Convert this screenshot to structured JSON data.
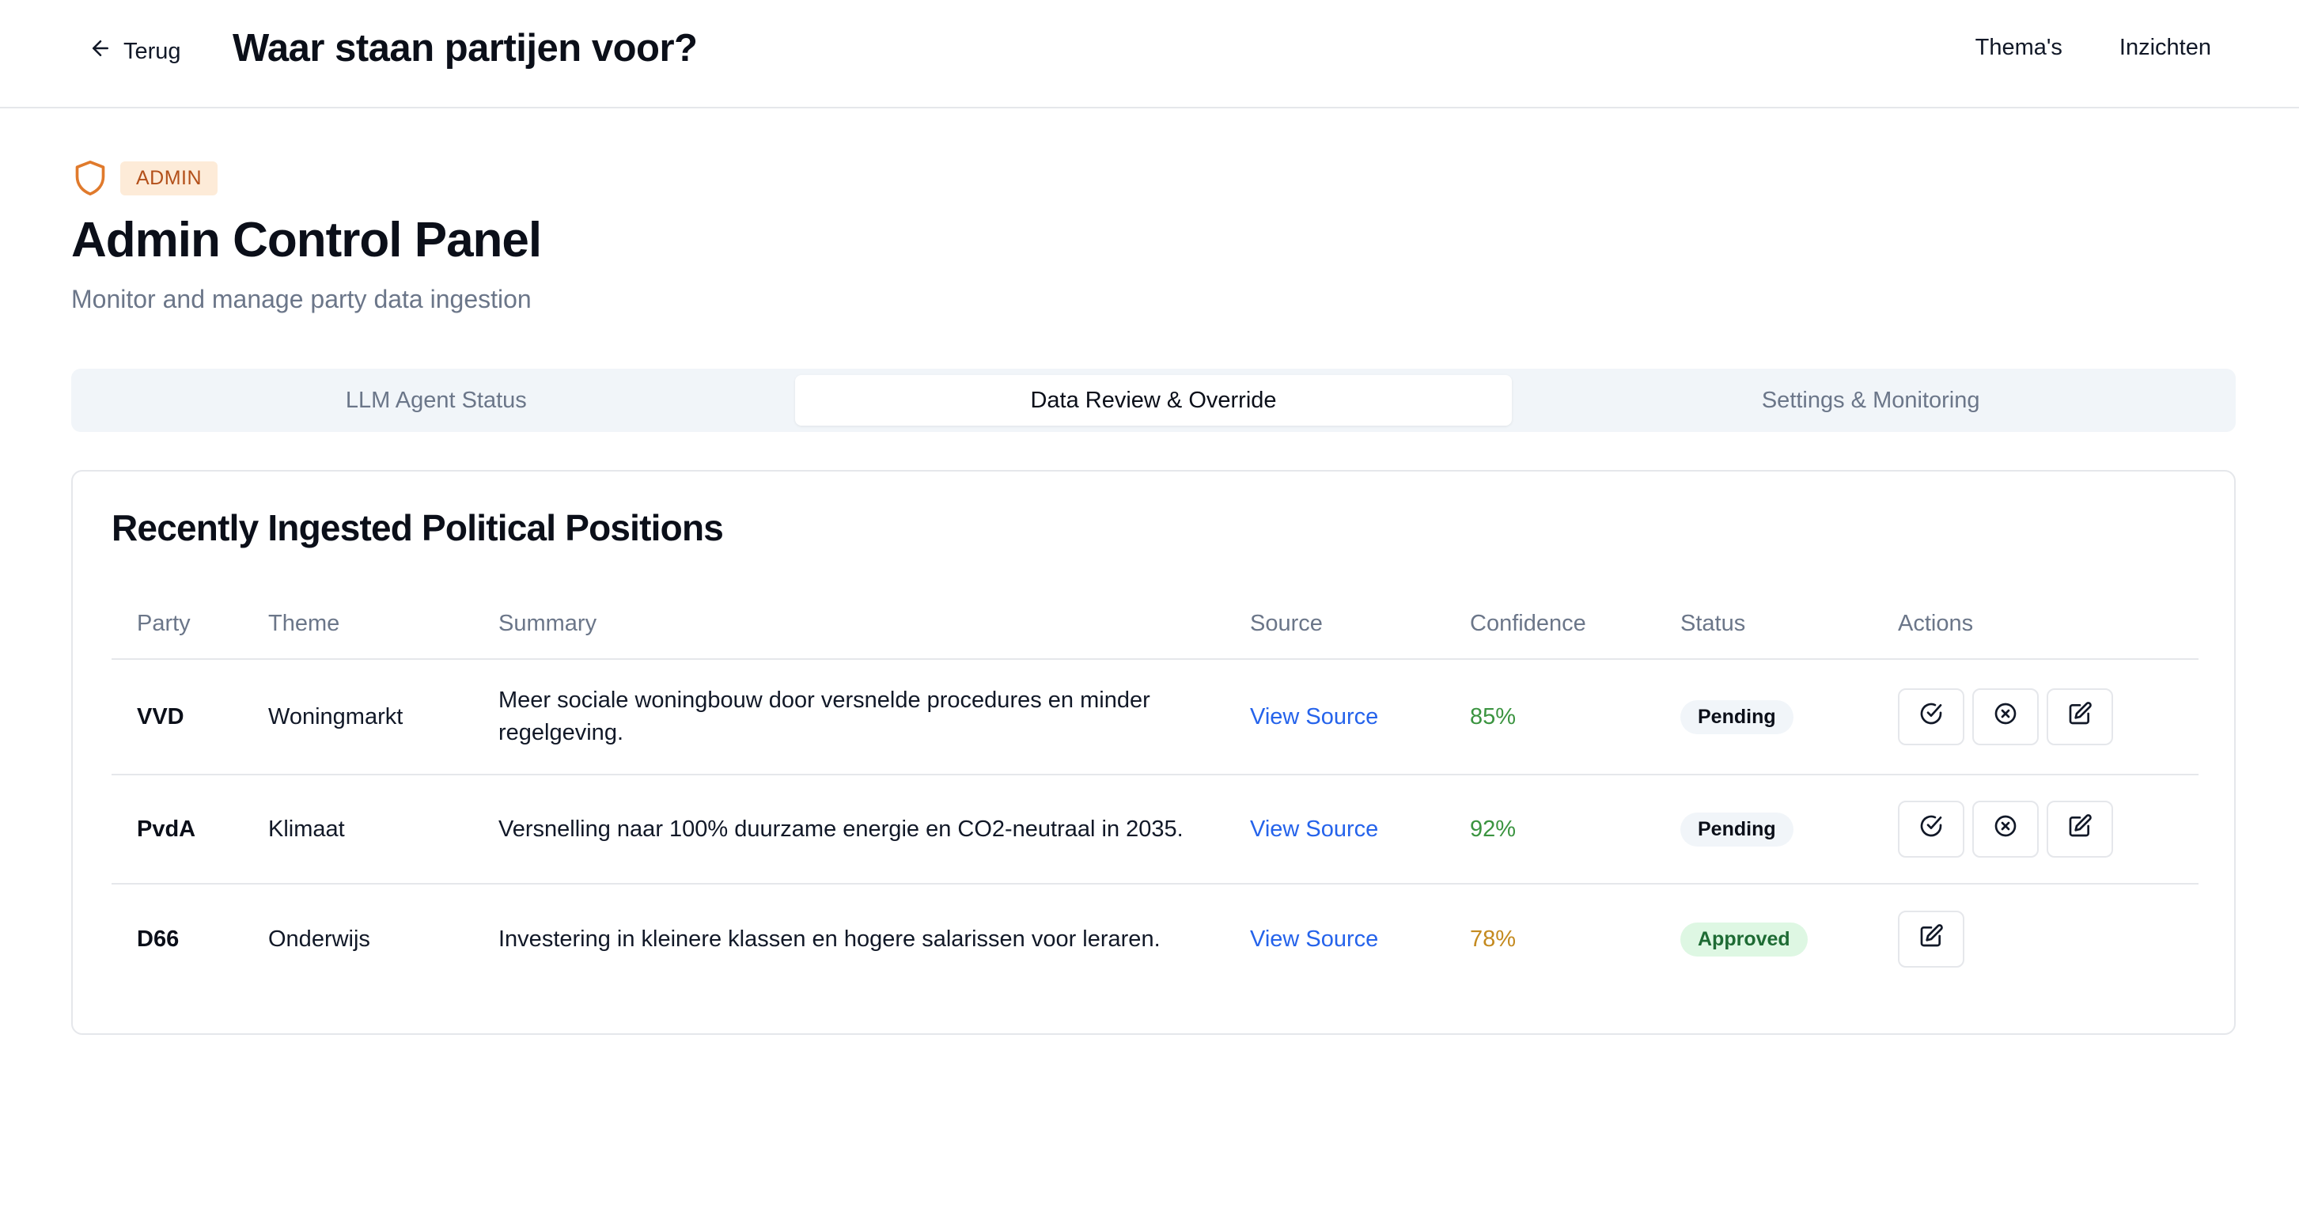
{
  "header": {
    "back_label": "Terug",
    "site_title": "Waar staan partijen voor?",
    "nav": [
      "Thema's",
      "Inzichten"
    ]
  },
  "page": {
    "badge": "ADMIN",
    "title": "Admin Control Panel",
    "subtitle": "Monitor and manage party data ingestion",
    "accent_color": "#e07a2c"
  },
  "tabs": [
    {
      "label": "LLM Agent Status",
      "active": false
    },
    {
      "label": "Data Review & Override",
      "active": true
    },
    {
      "label": "Settings & Monitoring",
      "active": false
    }
  ],
  "card": {
    "title": "Recently Ingested Political Positions",
    "columns": [
      "Party",
      "Theme",
      "Summary",
      "Source",
      "Confidence",
      "Status",
      "Actions"
    ],
    "rows": [
      {
        "party": "VVD",
        "theme": "Woningmarkt",
        "summary": "Meer sociale woningbouw door versnelde procedures en minder regelgeving.",
        "source": "View Source",
        "confidence": "85%",
        "status": "Pending",
        "actions": [
          "check-circle-icon",
          "x-circle-icon",
          "edit-icon"
        ]
      },
      {
        "party": "PvdA",
        "theme": "Klimaat",
        "summary": "Versnelling naar 100% duurzame energie en CO2-neutraal in 2035.",
        "source": "View Source",
        "confidence": "92%",
        "status": "Pending",
        "actions": [
          "check-circle-icon",
          "x-circle-icon",
          "edit-icon"
        ]
      },
      {
        "party": "D66",
        "theme": "Onderwijs",
        "summary": "Investering in kleinere klassen en hogere salarissen voor leraren.",
        "source": "View Source",
        "confidence": "78%",
        "status": "Approved",
        "actions": [
          "edit-icon"
        ]
      }
    ]
  },
  "colors": {
    "link": "#2563eb",
    "confidence_high": "#3b9440",
    "confidence_medium": "#c48a1f",
    "approved_bg": "#def7e3",
    "pending_bg": "#f1f5f9"
  }
}
